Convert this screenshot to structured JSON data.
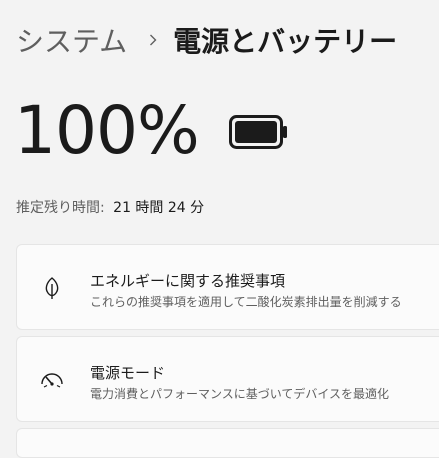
{
  "breadcrumb": {
    "parent": "システム",
    "current": "電源とバッテリー"
  },
  "battery": {
    "percent_text": "100%",
    "level": 1.0
  },
  "estimate": {
    "label": "推定残り時間:",
    "value": "21 時間 24 分"
  },
  "cards": [
    {
      "icon": "leaf-icon",
      "title": "エネルギーに関する推奨事項",
      "subtitle": "これらの推奨事項を適用して二酸化炭素排出量を削減する"
    },
    {
      "icon": "gauge-icon",
      "title": "電源モード",
      "subtitle": "電力消費とパフォーマンスに基づいてデバイスを最適化"
    }
  ]
}
